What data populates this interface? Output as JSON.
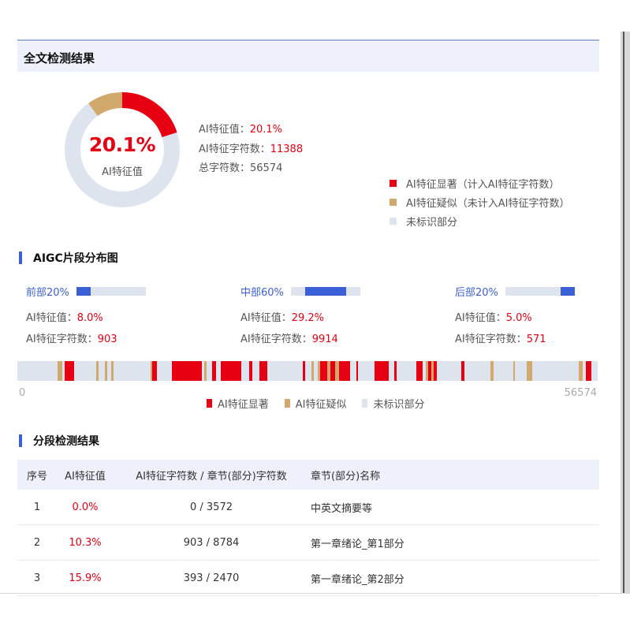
{
  "section": {
    "title": "全文检测结果"
  },
  "summary": {
    "percent_label": "20.1%",
    "donut_label": "AI特征值",
    "ai_value_label": "AI特征值：",
    "ai_value": "20.1%",
    "ai_chars_label": "AI特征字符数：",
    "ai_chars": "11388",
    "total_chars_label": "总字符数：",
    "total_chars": "56574",
    "significant_fraction": 0.201,
    "suspected_fraction": 0.1
  },
  "legend": {
    "significant": "AI特征显著（计入AI特征字符数）",
    "suspected": "AI特征疑似（未计入AI特征字符数）",
    "unmarked": "未标识部分"
  },
  "distribution": {
    "title": "AIGC片段分布图",
    "parts": [
      {
        "name": "前部20%",
        "ai_value_label": "AI特征值：",
        "ai_value": "8.0%",
        "ai_chars_label": "AI特征字符数：",
        "ai_chars": "903",
        "range": [
          0.0,
          0.2
        ]
      },
      {
        "name": "中部60%",
        "ai_value_label": "AI特征值：",
        "ai_value": "29.2%",
        "ai_chars_label": "AI特征字符数：",
        "ai_chars": "9914",
        "range": [
          0.2,
          0.8
        ]
      },
      {
        "name": "后部20%",
        "ai_value_label": "AI特征值：",
        "ai_value": "5.0%",
        "ai_chars_label": "AI特征字符数：",
        "ai_chars": "571",
        "range": [
          0.8,
          1.0
        ]
      }
    ],
    "axis_start": "0",
    "axis_end": "56574",
    "legend": {
      "significant": "AI特征显著",
      "suspected": "AI特征疑似",
      "unmarked": "未标识部分"
    },
    "segments": [
      {
        "type": "tan",
        "from": 0.069,
        "to": 0.077
      },
      {
        "type": "red",
        "from": 0.081,
        "to": 0.098
      },
      {
        "type": "tan",
        "from": 0.136,
        "to": 0.14
      },
      {
        "type": "tan",
        "from": 0.151,
        "to": 0.155
      },
      {
        "type": "tan",
        "from": 0.162,
        "to": 0.166
      },
      {
        "type": "tan",
        "from": 0.229,
        "to": 0.233
      },
      {
        "type": "red",
        "from": 0.233,
        "to": 0.24
      },
      {
        "type": "red",
        "from": 0.266,
        "to": 0.318
      },
      {
        "type": "tan",
        "from": 0.322,
        "to": 0.326
      },
      {
        "type": "red",
        "from": 0.336,
        "to": 0.342
      },
      {
        "type": "red",
        "from": 0.35,
        "to": 0.386
      },
      {
        "type": "red",
        "from": 0.4,
        "to": 0.405
      },
      {
        "type": "red",
        "from": 0.417,
        "to": 0.431
      },
      {
        "type": "red",
        "from": 0.492,
        "to": 0.496
      },
      {
        "type": "tan",
        "from": 0.507,
        "to": 0.511
      },
      {
        "type": "tan",
        "from": 0.517,
        "to": 0.522
      },
      {
        "type": "red",
        "from": 0.522,
        "to": 0.534
      },
      {
        "type": "tan",
        "from": 0.534,
        "to": 0.539
      },
      {
        "type": "red",
        "from": 0.539,
        "to": 0.548
      },
      {
        "type": "tan",
        "from": 0.548,
        "to": 0.554
      },
      {
        "type": "red",
        "from": 0.554,
        "to": 0.574
      },
      {
        "type": "red",
        "from": 0.584,
        "to": 0.587
      },
      {
        "type": "red",
        "from": 0.615,
        "to": 0.622
      },
      {
        "type": "red",
        "from": 0.621,
        "to": 0.64
      },
      {
        "type": "red",
        "from": 0.649,
        "to": 0.654
      },
      {
        "type": "red",
        "from": 0.688,
        "to": 0.698
      },
      {
        "type": "tan",
        "from": 0.704,
        "to": 0.708
      },
      {
        "type": "red",
        "from": 0.708,
        "to": 0.713
      },
      {
        "type": "tan",
        "from": 0.713,
        "to": 0.718
      },
      {
        "type": "red",
        "from": 0.718,
        "to": 0.723
      },
      {
        "type": "red",
        "from": 0.765,
        "to": 0.77
      },
      {
        "type": "tan",
        "from": 0.815,
        "to": 0.82
      },
      {
        "type": "tan",
        "from": 0.854,
        "to": 0.858
      },
      {
        "type": "tan",
        "from": 0.878,
        "to": 0.887
      },
      {
        "type": "tan",
        "from": 0.967,
        "to": 0.974
      },
      {
        "type": "red",
        "from": 0.98,
        "to": 0.989
      }
    ]
  },
  "table": {
    "title": "分段检测结果",
    "headers": [
      "序号",
      "AI特征值",
      "AI特征字符数 / 章节(部分)字符数",
      "章节(部分)名称"
    ],
    "rows": [
      [
        "1",
        "0.0%",
        "0 / 3572",
        "中英文摘要等"
      ],
      [
        "2",
        "10.3%",
        "903 / 8784",
        "第一章绪论_第1部分"
      ],
      [
        "3",
        "15.9%",
        "393 / 2470",
        "第一章绪论_第2部分"
      ]
    ]
  },
  "colors": {
    "significant": "#e60012",
    "suspected": "#d1a96d",
    "unmarked": "#dde4ee",
    "accent": "#3b5fd6"
  }
}
